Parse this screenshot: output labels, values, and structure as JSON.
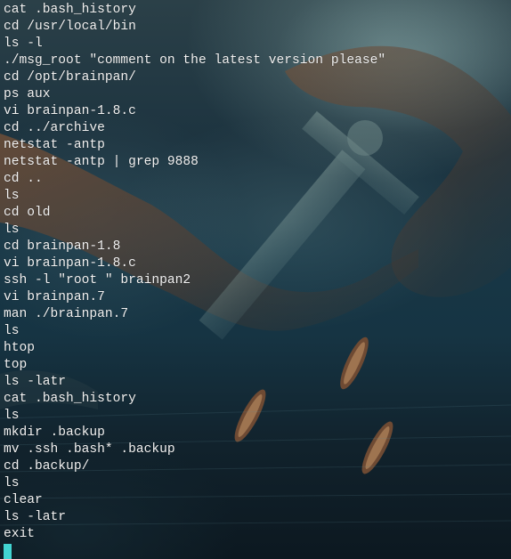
{
  "terminal": {
    "history_lines": [
      "cat .bash_history",
      "cd /usr/local/bin",
      "ls -l",
      "./msg_root \"comment on the latest version please\"",
      "cd /opt/brainpan/",
      "ps aux",
      "vi brainpan-1.8.c",
      "cd ../archive",
      "netstat -antp",
      "netstat -antp | grep 9888",
      "cd ..",
      "ls",
      "cd old",
      "ls",
      "cd brainpan-1.8",
      "vi brainpan-1.8.c",
      "ssh -l \"root \" brainpan2",
      "vi brainpan.7",
      "man ./brainpan.7",
      "ls",
      "htop",
      "top",
      "ls -latr",
      "cat .bash_history",
      "ls",
      "mkdir .backup",
      "mv .ssh .bash* .backup",
      "cd .backup/",
      "ls",
      "clear",
      "ls -latr",
      "exit"
    ],
    "text_color": "#f2f2f2",
    "cursor_color": "#42d4d2"
  }
}
